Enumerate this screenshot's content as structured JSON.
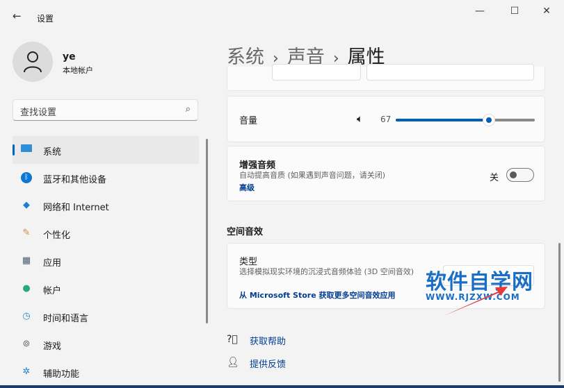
{
  "window": {
    "title": "设置",
    "back_icon": "arrow-left",
    "controls": [
      "minimize",
      "maximize",
      "close"
    ]
  },
  "user": {
    "name": "ye",
    "account_type": "本地帐户"
  },
  "search": {
    "placeholder": "查找设置"
  },
  "nav": [
    {
      "label": "系统",
      "icon": "monitor",
      "active": true
    },
    {
      "label": "蓝牙和其他设备",
      "icon": "bluetooth"
    },
    {
      "label": "网络和 Internet",
      "icon": "wifi"
    },
    {
      "label": "个性化",
      "icon": "brush"
    },
    {
      "label": "应用",
      "icon": "apps"
    },
    {
      "label": "帐户",
      "icon": "person"
    },
    {
      "label": "时间和语言",
      "icon": "globe-clock"
    },
    {
      "label": "游戏",
      "icon": "gamepad"
    },
    {
      "label": "辅助功能",
      "icon": "accessibility"
    }
  ],
  "breadcrumb": [
    "系统",
    "声音",
    "属性"
  ],
  "volume": {
    "label": "音量",
    "value": "67",
    "percent": 67
  },
  "enhance": {
    "title": "增强音频",
    "desc": "自动提高音质 (如果遇到声音问题，请关闭)",
    "link": "高级",
    "state_label": "关",
    "on": false
  },
  "spatial": {
    "section": "空间音效",
    "title": "类型",
    "desc": "选择模拟现实环境的沉浸式音频体验 (3D 空间音效)",
    "link": "从 Microsoft Store 获取更多空间音效应用"
  },
  "help": {
    "get_help": "获取帮助",
    "feedback": "提供反馈"
  },
  "watermark": {
    "name": "软件自学网",
    "url": "WWW.RJZXW.COM"
  },
  "colors": {
    "accent": "#005fb8",
    "link": "#003e92"
  }
}
